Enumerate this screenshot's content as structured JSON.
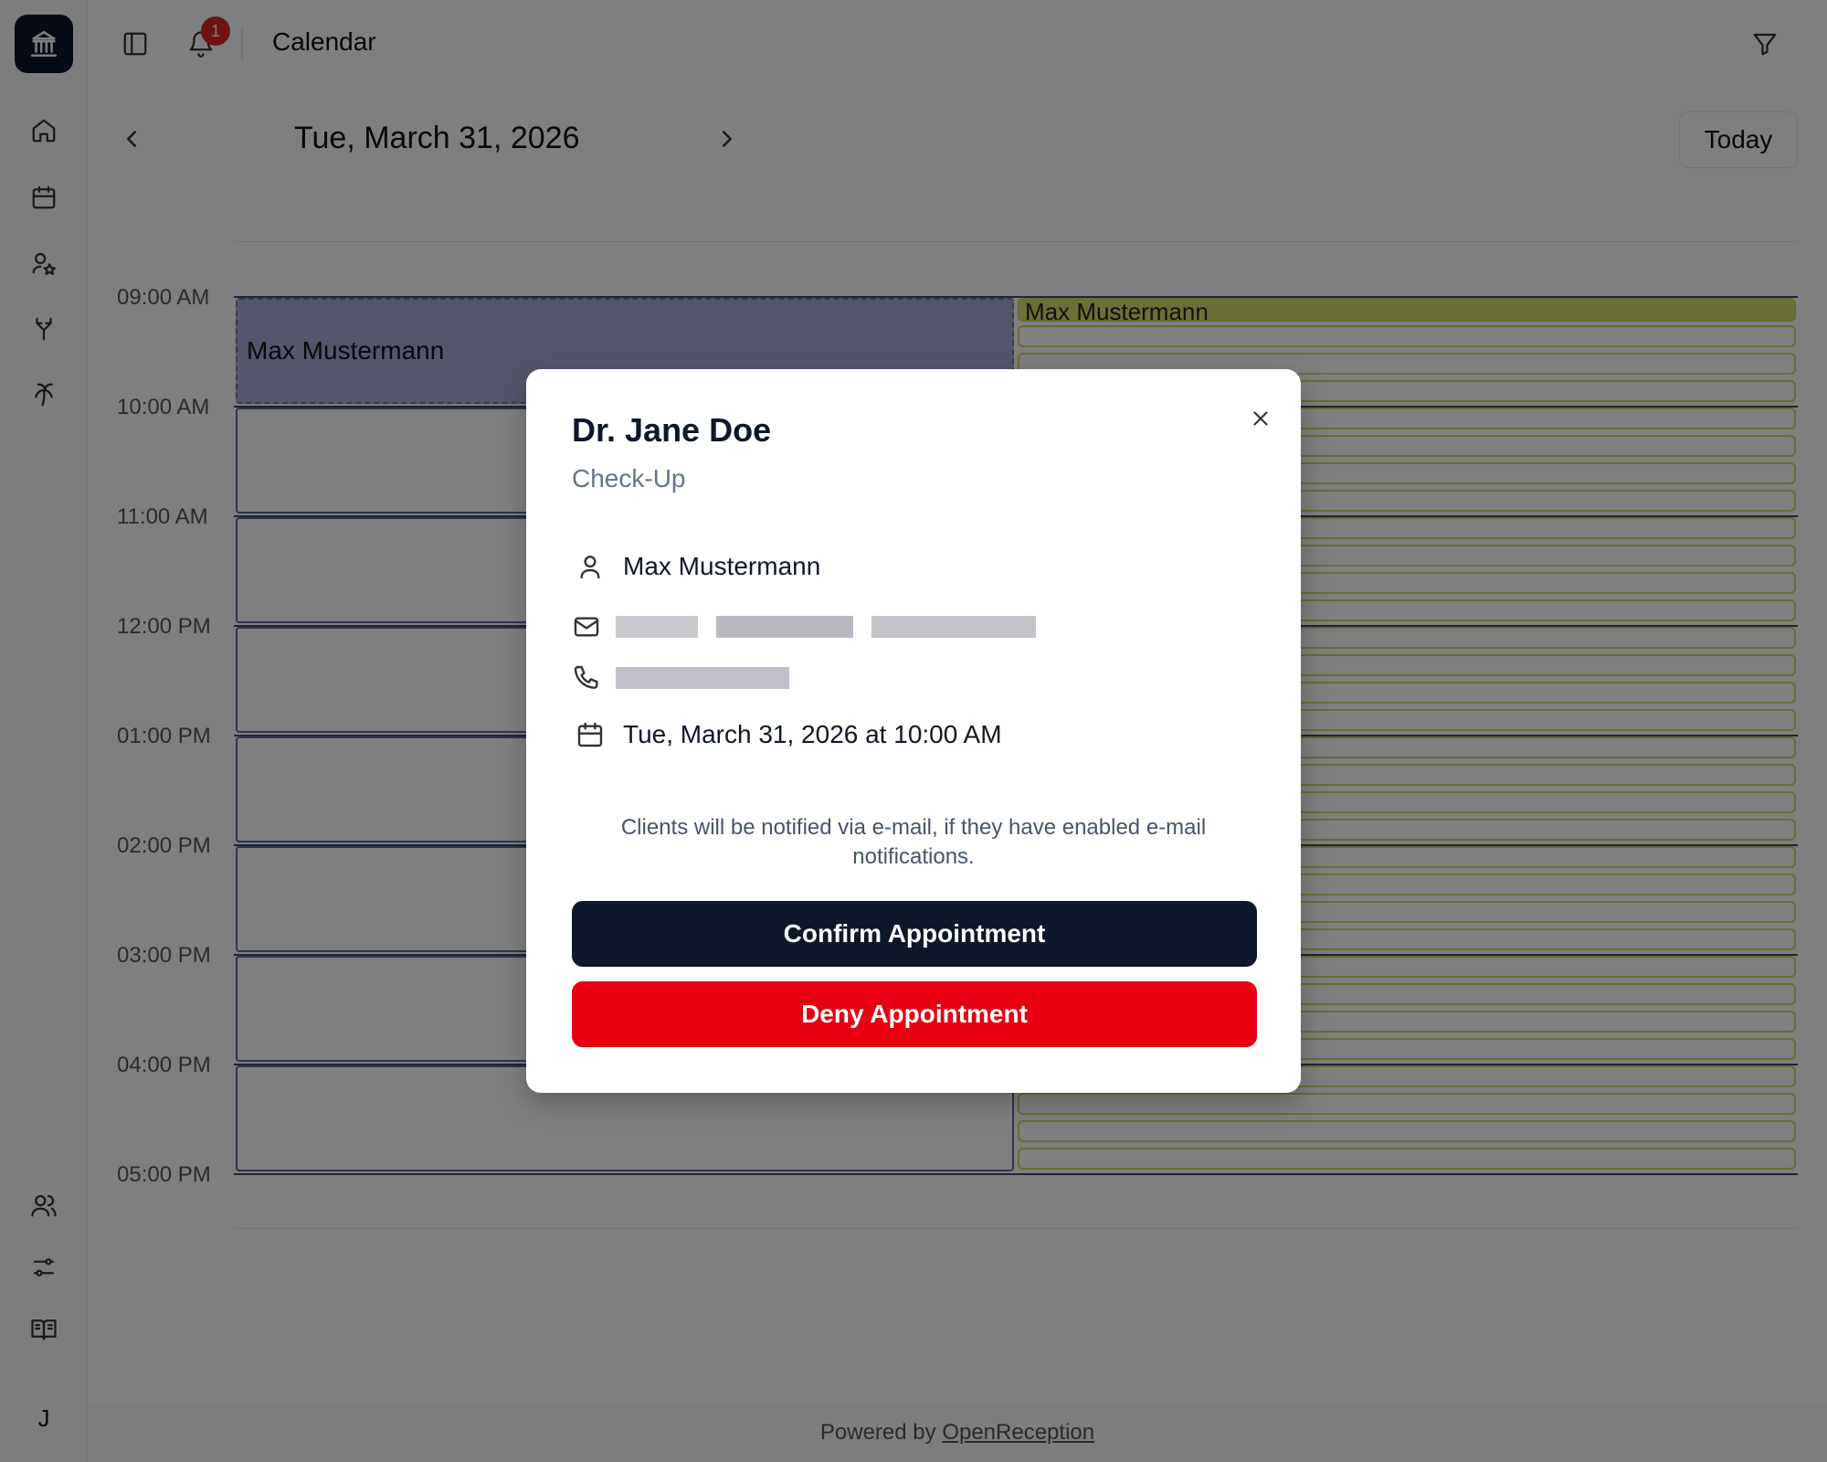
{
  "header": {
    "title": "Calendar",
    "notification_count": "1"
  },
  "date_nav": {
    "date": "Tue, March 31, 2026",
    "today_label": "Today"
  },
  "calendar": {
    "hours": [
      "09:00 AM",
      "10:00 AM",
      "11:00 AM",
      "12:00 PM",
      "01:00 PM",
      "02:00 PM",
      "03:00 PM",
      "04:00 PM",
      "05:00 PM"
    ],
    "left_event_name": "Max Mustermann",
    "right_event_name": "Max Mustermann"
  },
  "footer": {
    "powered_prefix": "Powered by",
    "powered_link": "OpenReception"
  },
  "modal": {
    "title": "Dr. Jane Doe",
    "subtitle": "Check-Up",
    "client_name": "Max Mustermann",
    "datetime": "Tue, March 31, 2026 at 10:00 AM",
    "note": "Clients will be notified via e-mail, if they have enabled e-mail notifications.",
    "confirm_label": "Confirm Appointment",
    "deny_label": "Deny Appointment"
  },
  "sidebar": {
    "user_initial": "J"
  },
  "colors": {
    "primary": "#0f172a",
    "danger": "#e60012",
    "event_left": "#a9acd6",
    "event_right": "#d7e06d"
  }
}
